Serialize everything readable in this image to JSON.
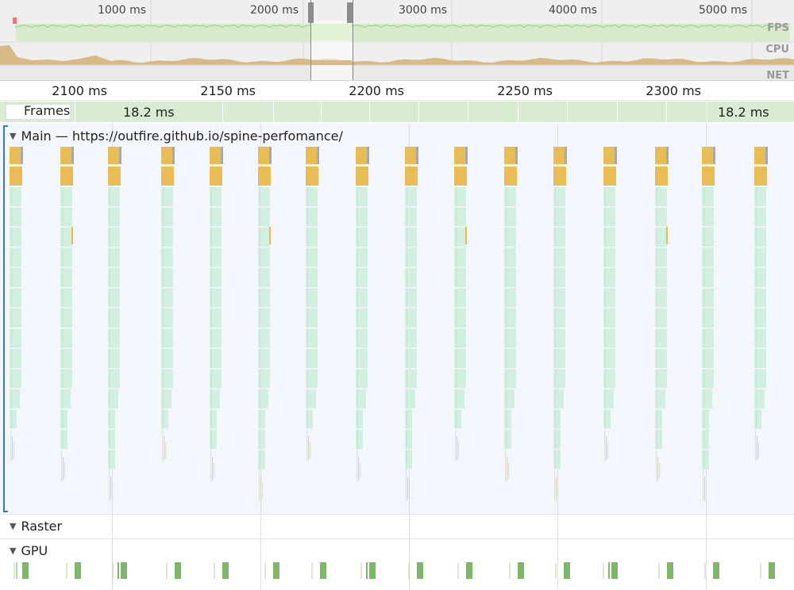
{
  "overview": {
    "ruler_labels": [
      "1000 ms",
      "2000 ms",
      "3000 ms",
      "4000 ms",
      "5000 ms"
    ],
    "track_labels": {
      "fps": "FPS",
      "cpu": "CPU",
      "net": "NET"
    }
  },
  "detail": {
    "ruler_labels": [
      "2100 ms",
      "2150 ms",
      "2200 ms",
      "2250 ms",
      "2300 ms"
    ]
  },
  "frames": {
    "label": "Frames",
    "first_duration": "18.2 ms",
    "last_duration": "18.2 ms"
  },
  "main": {
    "title": "Main — https://outfire.github.io/spine-perfomance/"
  },
  "raster": {
    "title": "Raster"
  },
  "gpu": {
    "title": "GPU"
  },
  "colors": {
    "task_yellow": "#e9bd55",
    "task_gray": "#a9a9a9",
    "script_green": "#d2efdf",
    "paint_green": "#7fb768",
    "fps_green": "#d7ebcb",
    "cpu_tan": "#d9b985",
    "selection_blue": "#3b73d1"
  },
  "icons": {
    "expand": "triangle-down-icon"
  }
}
